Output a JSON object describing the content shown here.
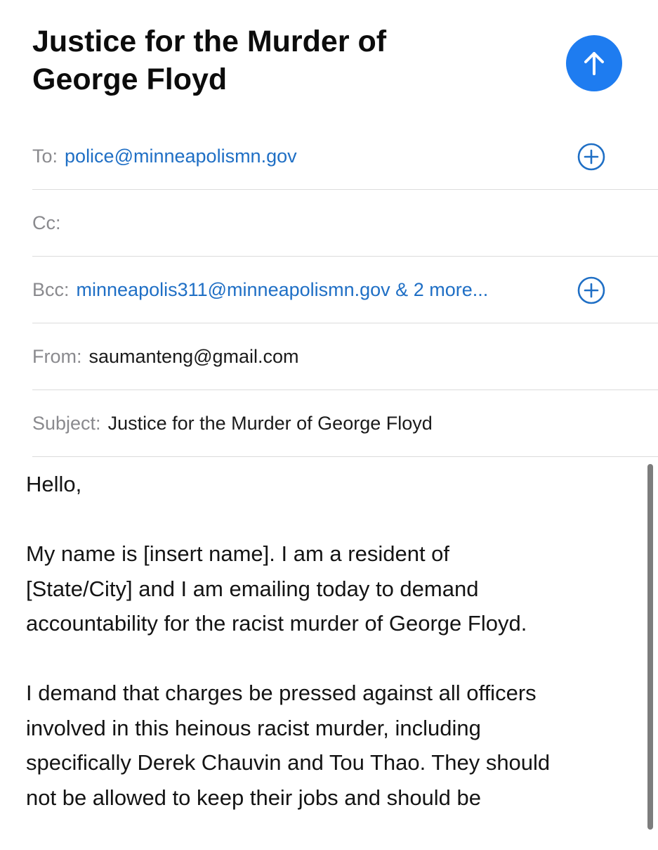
{
  "compose": {
    "title": "Justice for the Murder of\nGeorge Floyd"
  },
  "fields": {
    "to_label": "To:",
    "to_value": "police@minneapolismn.gov",
    "cc_label": "Cc:",
    "cc_value": "",
    "bcc_label": "Bcc:",
    "bcc_value": "minneapolis311@minneapolismn.gov & 2 more...",
    "from_label": "From:",
    "from_value": "saumanteng@gmail.com",
    "subject_label": "Subject:",
    "subject_value": "Justice for the Murder of George Floyd"
  },
  "body": {
    "paragraphs": [
      "Hello,",
      "My name is [insert name]. I am a resident of\n[State/City] and I am emailing today to demand\naccountability for the racist murder of George Floyd.",
      "I demand that charges be pressed against all officers\ninvolved in this heinous racist murder, including\nspecifically Derek Chauvin and Tou Thao. They should\nnot be allowed to keep their jobs and should be"
    ]
  },
  "icons": {
    "send": "arrow-up-icon",
    "add_contact": "plus-circle-icon"
  },
  "colors": {
    "accent": "#1e7cf0",
    "link": "#1f6fc5",
    "label": "#8a8a8e",
    "divider": "#dcdcdc"
  }
}
